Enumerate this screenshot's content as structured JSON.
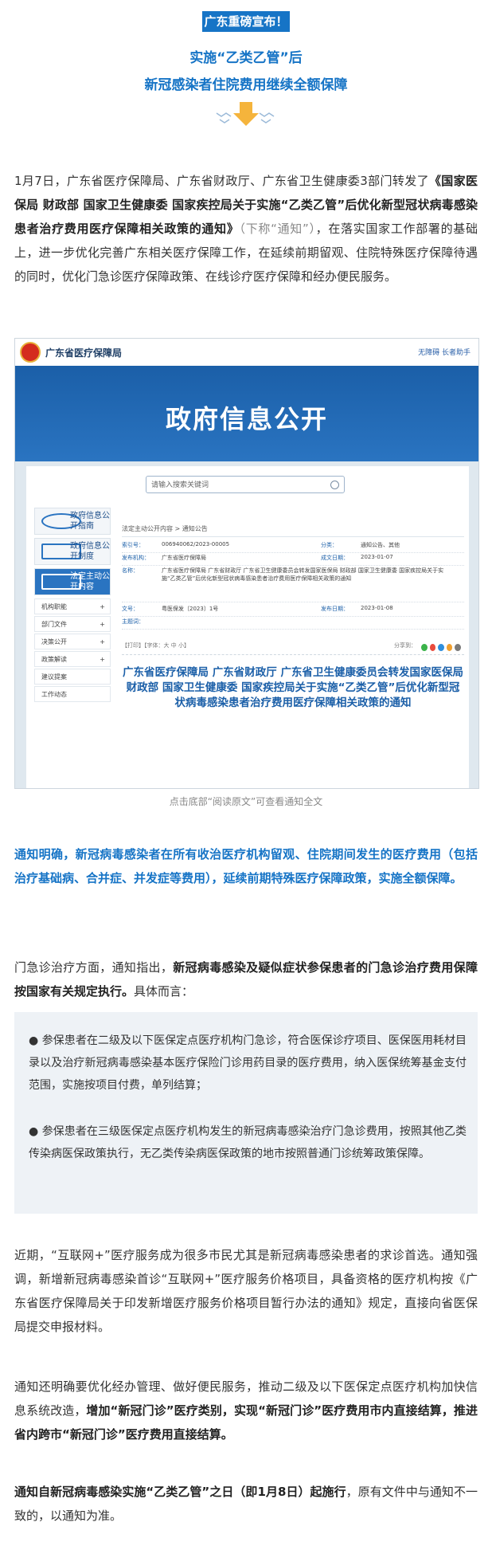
{
  "header": {
    "tag": "广东重磅宣布！",
    "line1": "实施“乙类乙管”后",
    "line2": "新冠感染者住院费用继续全额保障"
  },
  "intro": {
    "part1": "1月7日，广东省医疗保障局、广东省财政厅、广东省卫生健康委3部门转发了",
    "bold": "《国家医保局 财政部 国家卫生健康委 国家疾控局关于实施“乙类乙管”后优化新型冠状病毒感染患者治疗费用医疗保障相关政策的通知》",
    "gray": "（下称“通知”）",
    "part2": "，在落实国家工作部署的基础上，进一步优化完善广东相关医疗保障工作，在延续前期留观、住院特殊医疗保障待遇的同时，优化门急诊医疗保障政策、在线诊疗医疗保障和经办便民服务。"
  },
  "screenshot": {
    "site_name": "广东省医疗保障局",
    "top_links": "无障碍   长者助手",
    "banner_title": "政府信息公开",
    "search_placeholder": "请输入搜索关键词",
    "side_boxes": [
      "政府信息公开指南",
      "政府信息公开制度",
      "法定主动公开内容"
    ],
    "side_items": [
      "机构职能",
      "部门文件",
      "决策公开",
      "政策解读",
      "建议提案",
      "工作动态"
    ],
    "breadcrumb": "法定主动公开内容 > 通知公告",
    "meta": [
      {
        "label": "索引号：",
        "value": "006940062/2023-00005",
        "label2": "分类：",
        "value2": "通知公告、其他"
      },
      {
        "label": "发布机构：",
        "value": "广东省医疗保障局",
        "label2": "成文日期：",
        "value2": "2023-01-07"
      },
      {
        "label": "名称：",
        "value": "广东省医疗保障局 广东省财政厅 广东省卫生健康委员会转发国家医保局 财政部 国家卫生健康委 国家疾控局关于实施“乙类乙管”后优化新型冠状病毒感染患者治疗费用医疗保障相关政策的通知",
        "label2": "",
        "value2": ""
      },
      {
        "label": "文号：",
        "value": "粤医保发〔2023〕1号",
        "label2": "发布日期：",
        "value2": "2023-01-08"
      },
      {
        "label": "主题词：",
        "value": "",
        "label2": "",
        "value2": ""
      }
    ],
    "tools": "【打印】【字体：大 中 小】",
    "share": "分享到：",
    "headline": "广东省医疗保障局 广东省财政厅 广东省卫生健康委员会转发国家医保局 财政部 国家卫生健康委 国家疾控局关于实施“乙类乙管”后优化新型冠状病毒感染患者治疗费用医疗保障相关政策的通知"
  },
  "caption": "点击底部“阅读原文”可查看通知全文",
  "inpatient": "通知明确，新冠病毒感染者在所有收治医疗机构留观、住院期间发生的医疗费用（包括治疗基础病、合并症、并发症等费用），延续前期特殊医疗保障政策，实施全额保障。",
  "outpatient": {
    "part1": "门急诊治疗方面，通知指出，",
    "bold": "新冠病毒感染及疑似症状参保患者的门急诊治疗费用保障按国家有关规定执行。",
    "part2": "具体而言："
  },
  "quote": [
    "● 参保患者在二级及以下医保定点医疗机构门急诊，符合医保诊疗项目、医保医用耗材目录以及治疗新冠病毒感染基本医疗保险门诊用药目录的医疗费用，纳入医保统筹基金支付范围，实施按项目付费，单列结算；",
    "● 参保患者在三级医保定点医疗机构发生的新冠病毒感染治疗门急诊费用，按照其他乙类传染病医保政策执行，无乙类传染病医保政策的地市按照普通门诊统筹政策保障。"
  ],
  "internet": "近期，“互联网+”医疗服务成为很多市民尤其是新冠病毒感染患者的求诊首选。通知强调，新增新冠病毒感染首诊“互联网+”医疗服务价格项目，具备资格的医疗机构按《广东省医疗保障局关于印发新增医疗服务价格项目暂行办法的通知》规定，直接向省医保局提交申报材料。",
  "service": {
    "part1": "通知还明确要优化经办管理、做好便民服务，推动二级及以下医保定点医疗机构加快信息系统改造，",
    "bold": "增加“新冠门诊”医疗类别，实现“新冠门诊”医疗费用市内直接结算，推进省内跨市“新冠门诊”医疗费用直接结算。"
  },
  "effective": {
    "bold": "通知自新冠病毒感染实施“乙类乙管”之日（即1月8日）起施行",
    "part2": "，原有文件中与通知不一致的，以通知为准。"
  }
}
